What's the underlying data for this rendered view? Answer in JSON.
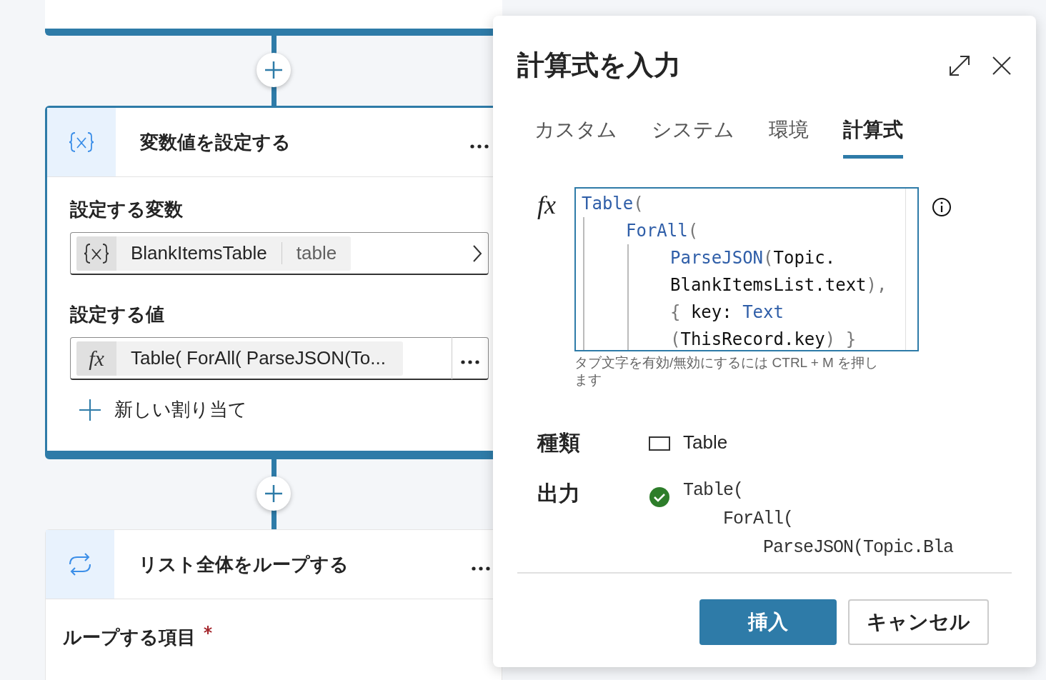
{
  "canvas": {
    "cards": [
      {
        "kind": "set_variable",
        "title": "変数値を設定する",
        "selected": true,
        "variable_label": "設定する変数",
        "variable": {
          "name": "BlankItemsTable",
          "type": "table"
        },
        "value_label": "設定する値",
        "value_icon": "fx",
        "value": "Table( ForAll( ParseJSON(To...",
        "add_label": "新しい割り当て"
      },
      {
        "kind": "loop",
        "title": "リスト全体をループする",
        "selected": false,
        "field_label": "ループする項目",
        "required": true
      }
    ]
  },
  "panel": {
    "title": "計算式を入力",
    "tabs": [
      {
        "label": "カスタム",
        "selected": false
      },
      {
        "label": "システム",
        "selected": false
      },
      {
        "label": "環境",
        "selected": false
      },
      {
        "label": "計算式",
        "selected": true
      }
    ],
    "editor": {
      "icon": "fx",
      "lines": [
        {
          "tokens": [
            {
              "kind": "function",
              "text": "Table"
            },
            {
              "kind": "punct",
              "text": "("
            }
          ],
          "children": [
            {
              "tokens": [
                {
                  "kind": "function",
                  "text": "ForAll"
                },
                {
                  "kind": "punct",
                  "text": "("
                }
              ],
              "children": [
                {
                  "tokens": [
                    {
                      "kind": "function",
                      "text": "ParseJSON"
                    },
                    {
                      "kind": "punct",
                      "text": "("
                    },
                    {
                      "kind": "plain",
                      "text": "Topic."
                    }
                  ]
                },
                {
                  "tokens": [
                    {
                      "kind": "plain",
                      "text": "BlankItemsList.text"
                    },
                    {
                      "kind": "punct",
                      "text": "),"
                    }
                  ]
                },
                {
                  "tokens": [
                    {
                      "kind": "punct",
                      "text": "{"
                    },
                    {
                      "kind": "plain",
                      "text": " key: "
                    },
                    {
                      "kind": "function",
                      "text": "Text"
                    }
                  ]
                },
                {
                  "tokens": [
                    {
                      "kind": "punct",
                      "text": "("
                    },
                    {
                      "kind": "plain",
                      "text": "ThisRecord.key"
                    },
                    {
                      "kind": "punct",
                      "text": ") }"
                    }
                  ]
                }
              ]
            }
          ]
        }
      ],
      "hint": "タブ文字を有効/無効にするには CTRL + M を押します"
    },
    "type_label": "種類",
    "type_value": "Table",
    "output_label": "出力",
    "output_valid": true,
    "output": [
      {
        "text": "Table(",
        "children": [
          {
            "text": "ForAll(",
            "children": [
              {
                "text": "ParseJSON(Topic.Bla"
              }
            ]
          }
        ]
      }
    ],
    "buttons": [
      {
        "kind": "primary",
        "label": "挿入"
      },
      {
        "kind": "secondary",
        "label": "キャンセル"
      }
    ]
  }
}
